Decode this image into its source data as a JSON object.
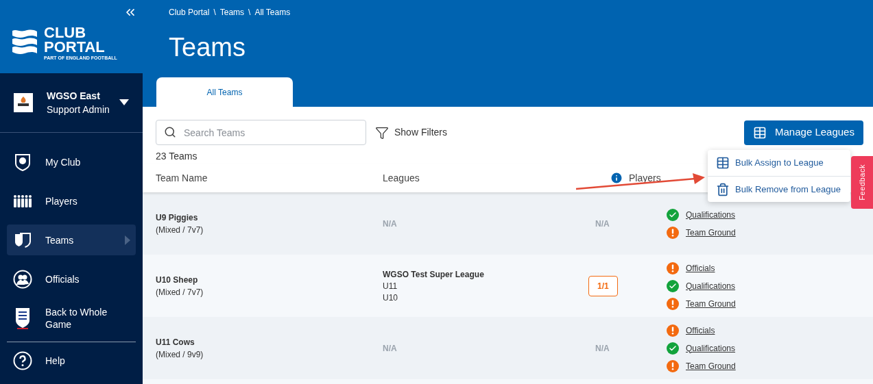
{
  "sidebar": {
    "logo": {
      "line1": "CLUB",
      "line2": "PORTAL",
      "tagline": "PART OF ENGLAND FOOTBALL"
    },
    "club": {
      "name": "WGSO East",
      "role": "Support Admin"
    },
    "items": [
      {
        "label": "My Club",
        "selected": false
      },
      {
        "label": "Players",
        "selected": false
      },
      {
        "label": "Teams",
        "selected": true
      },
      {
        "label": "Officials",
        "selected": false
      },
      {
        "label": "Back to Whole Game",
        "selected": false
      },
      {
        "label": "Help",
        "selected": false
      }
    ]
  },
  "breadcrumb": [
    {
      "label": "Club Portal",
      "separator": "\\"
    },
    {
      "label": "Teams",
      "separator": "\\"
    },
    {
      "label": "All Teams"
    }
  ],
  "title": "Teams",
  "tabs": [
    {
      "label": "All Teams",
      "selected": true
    }
  ],
  "search": {
    "placeholder": "Search Teams"
  },
  "filters_button": "Show Filters",
  "manage_button": "Manage Leagues",
  "menu": [
    "Bulk Assign to League",
    "Bulk Remove from League"
  ],
  "feedback": "Feedback",
  "count": "23 Teams",
  "columns": [
    "Team Name",
    "Leagues",
    "Players"
  ],
  "rows": [
    {
      "name": "U9 Piggies",
      "format": "(Mixed / 7v7)",
      "leagues": {
        "kind": "none",
        "text": "N/A"
      },
      "players": {
        "kind": "none",
        "text": "N/A"
      },
      "checks": [
        {
          "label": "Qualifications",
          "kind": "ok"
        },
        {
          "label": "Team Ground",
          "kind": "warning"
        }
      ]
    },
    {
      "name": "U10 Sheep",
      "format": "(Mixed / 7v7)",
      "leagues": {
        "kind": "list",
        "name": "WGSO Test Super League",
        "divisions": [
          "U11",
          "U10"
        ]
      },
      "players": {
        "kind": "badge",
        "text": "1/1"
      },
      "checks": [
        {
          "label": "Officials",
          "kind": "warning"
        },
        {
          "label": "Qualifications",
          "kind": "ok"
        },
        {
          "label": "Team Ground",
          "kind": "warning"
        }
      ]
    },
    {
      "name": "U11 Cows",
      "format": "(Mixed / 9v9)",
      "leagues": {
        "kind": "none",
        "text": "N/A"
      },
      "players": {
        "kind": "none",
        "text": "N/A"
      },
      "checks": [
        {
          "label": "Officials",
          "kind": "warning"
        },
        {
          "label": "Qualifications",
          "kind": "ok"
        },
        {
          "label": "Team Ground",
          "kind": "warning"
        }
      ]
    }
  ]
}
